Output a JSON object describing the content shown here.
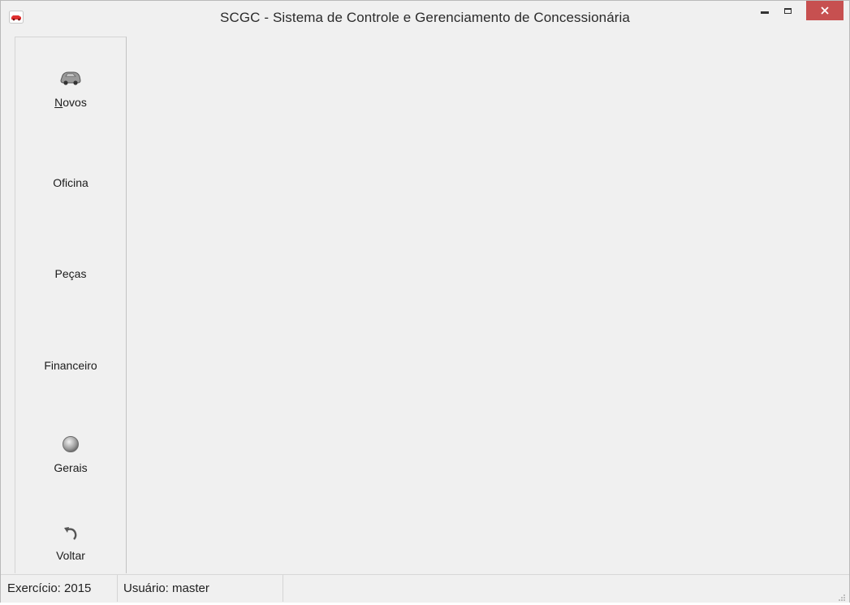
{
  "window": {
    "title": "SCGC - Sistema de Controle e Gerenciamento de Concessionária",
    "app_icon": "red-car-icon",
    "close_color": "#c75050"
  },
  "sidebar": {
    "items": [
      {
        "label": "Novos",
        "icon": "car-icon",
        "mnemonic": "N"
      },
      {
        "label": "Oficina",
        "icon": ""
      },
      {
        "label": "Peças",
        "icon": ""
      },
      {
        "label": "Financeiro",
        "icon": ""
      },
      {
        "label": "Gerais",
        "icon": "gray-circle-icon"
      },
      {
        "label": "Voltar",
        "icon": "undo-arrow-icon"
      }
    ]
  },
  "statusbar": {
    "exercicio": "Exercício: 2015",
    "usuario": "Usuário: master"
  }
}
